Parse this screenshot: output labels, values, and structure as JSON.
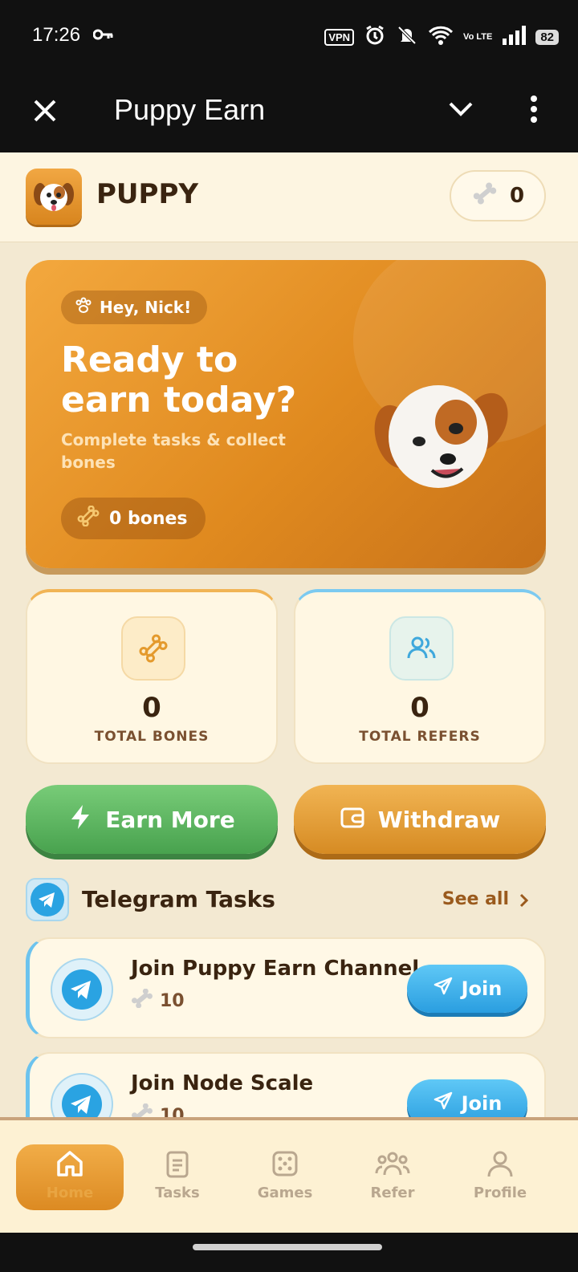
{
  "status_bar": {
    "time": "17:26",
    "vpn": "VPN",
    "volte": "Vo LTE",
    "battery": "82"
  },
  "app_bar": {
    "title": "Puppy Earn"
  },
  "header": {
    "brand": "PUPPY",
    "bone_balance": "0"
  },
  "hero": {
    "greeting": "Hey, Nick!",
    "headline": "Ready to earn today?",
    "subtitle": "Complete tasks & collect bones",
    "bones": "0 bones"
  },
  "stats": [
    {
      "value": "0",
      "label": "TOTAL BONES"
    },
    {
      "value": "0",
      "label": "TOTAL REFERS"
    }
  ],
  "actions": {
    "earn": "Earn More",
    "withdraw": "Withdraw"
  },
  "section": {
    "title": "Telegram Tasks",
    "see_all": "See all"
  },
  "tasks": [
    {
      "name": "Join Puppy Earn Channel",
      "reward": "10",
      "button": "Join"
    },
    {
      "name": "Join Node Scale",
      "reward": "10",
      "button": "Join"
    }
  ],
  "nav": [
    {
      "label": "Home",
      "active": true
    },
    {
      "label": "Tasks"
    },
    {
      "label": "Games"
    },
    {
      "label": "Refer"
    },
    {
      "label": "Profile"
    }
  ],
  "colors": {
    "accent": "#e08a1f",
    "green": "#48a24e",
    "blue": "#2a9ee0",
    "cream": "#fdf5e1"
  }
}
